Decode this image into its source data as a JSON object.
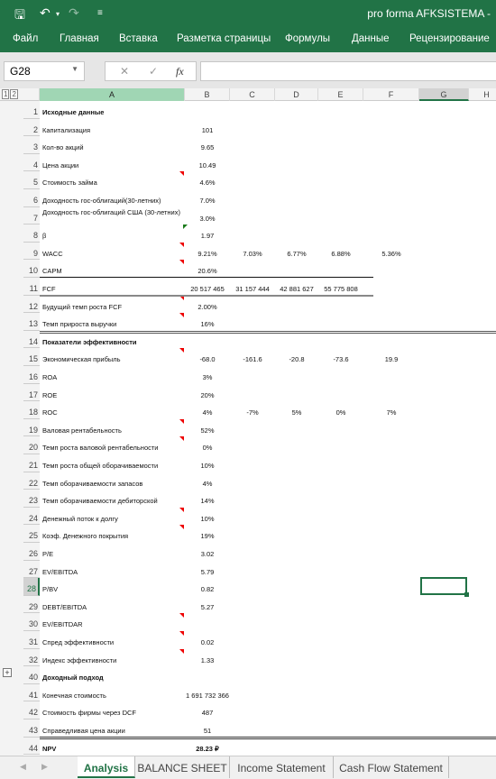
{
  "window": {
    "title": "pro forma AFKSISTEMA -",
    "save_icon": "save-icon",
    "undo_icon": "undo-icon",
    "redo_icon": "redo-icon",
    "customize_icon": "customize-quick-access-icon"
  },
  "ribbon": {
    "tabs": [
      "Файл",
      "Главная",
      "Вставка",
      "Разметка страницы",
      "Формулы",
      "Данные",
      "Рецензирование"
    ]
  },
  "formula_bar": {
    "name_box": "G28",
    "cancel": "✕",
    "enter": "✓",
    "fx": "fx",
    "formula": ""
  },
  "columns": [
    "A",
    "B",
    "C",
    "D",
    "E",
    "F",
    "G",
    "H"
  ],
  "selected_cell": "G28",
  "outline_levels": [
    "1",
    "2"
  ],
  "rows": [
    {
      "n": "1",
      "a": "Исходные данные",
      "bold": true
    },
    {
      "n": "2",
      "a": "Капитализация",
      "b": "101"
    },
    {
      "n": "3",
      "a": "Кол-во акций",
      "b": "9.65"
    },
    {
      "n": "4",
      "a": "Цена акции",
      "b": "10.49"
    },
    {
      "n": "5",
      "a": "Стоимость займа",
      "b": "4.6%",
      "comment": true
    },
    {
      "n": "6",
      "a": "Доходность гос-облигаций(30-летних)",
      "b": "7.0%"
    },
    {
      "n": "7",
      "a": "Доходность гос-облигаций США (30-летних)",
      "b": "3.0%",
      "wrap": true
    },
    {
      "n": "8",
      "a": "β",
      "b": "1.97",
      "green": true
    },
    {
      "n": "9",
      "a": "WACC",
      "b": "9.21%",
      "c": "7.03%",
      "d": "6.77%",
      "e": "6.88%",
      "f": "5.36%",
      "comment": true
    },
    {
      "n": "10",
      "a": "CAPM",
      "b": "20.6%",
      "comment": true
    },
    {
      "n": "11",
      "a": "FCF",
      "b": "20 517 465",
      "c": "31 157 444",
      "d": "42 881 627",
      "e": "55 775 808"
    },
    {
      "n": "12",
      "a": "Будущий темп роста FCF",
      "b": "2.00%",
      "comment": true
    },
    {
      "n": "13",
      "a": "Темп прироста выручки",
      "b": "16%",
      "comment": true
    },
    {
      "n": "14",
      "a": "Показатели эффективности",
      "bold": true
    },
    {
      "n": "15",
      "a": "Экономическая прибыль",
      "b": "-68.0",
      "c": "-161.6",
      "d": "-20.8",
      "e": "-73.6",
      "f": "19.9",
      "comment": true
    },
    {
      "n": "16",
      "a": "ROA",
      "b": "3%"
    },
    {
      "n": "17",
      "a": "ROE",
      "b": "20%"
    },
    {
      "n": "18",
      "a": "ROC",
      "b": "4%",
      "c": "-7%",
      "d": "5%",
      "e": "0%",
      "f": "7%"
    },
    {
      "n": "19",
      "a": "Валовая рентабельность",
      "b": "52%",
      "comment": true
    },
    {
      "n": "20",
      "a": "Темп роста валовой рентабельности",
      "b": "0%",
      "comment": true
    },
    {
      "n": "21",
      "a": "Темп роста общей оборачиваемости",
      "b": "10%"
    },
    {
      "n": "22",
      "a": "Темп оборачиваемости запасов",
      "b": "4%"
    },
    {
      "n": "23",
      "a": "Темп оборачиваемости дебиторской",
      "b": "14%"
    },
    {
      "n": "24",
      "a": "Денежный поток к долгу",
      "b": "10%",
      "comment": true
    },
    {
      "n": "25",
      "a": "Коэф. Денежного покрытия",
      "b": "19%",
      "comment": true
    },
    {
      "n": "26",
      "a": "P/E",
      "b": "3.02"
    },
    {
      "n": "27",
      "a": "EV/EBITDA",
      "b": "5.79"
    },
    {
      "n": "28",
      "a": "P/BV",
      "b": "0.82"
    },
    {
      "n": "29",
      "a": "DEBT/EBITDA",
      "b": "5.27"
    },
    {
      "n": "30",
      "a": "EV/EBITDAR",
      "comment": true
    },
    {
      "n": "31",
      "a": "Спред эффективности",
      "b": "0.02",
      "comment": true
    },
    {
      "n": "32",
      "a": "Индекс эффективности",
      "b": "1.33",
      "comment": true
    },
    {
      "n": "40",
      "a": "Доходный подход",
      "bold": true
    },
    {
      "n": "41",
      "a": "Конечная стоимость",
      "b": "1 691 732 366"
    },
    {
      "n": "42",
      "a": "Стоимость фирмы через DCF",
      "b": "487"
    },
    {
      "n": "43",
      "a": "Справедливая цена акции",
      "b": "51"
    },
    {
      "n": "44",
      "a": "NPV",
      "b": "28.23 ₽",
      "bold": true
    }
  ],
  "sheet_tabs": [
    "Analysis",
    "BALANCE SHEET",
    "Income Statement",
    "Cash Flow Statement"
  ],
  "active_sheet": "Analysis",
  "colors": {
    "accent": "#217346",
    "comment": "#ee0000"
  }
}
